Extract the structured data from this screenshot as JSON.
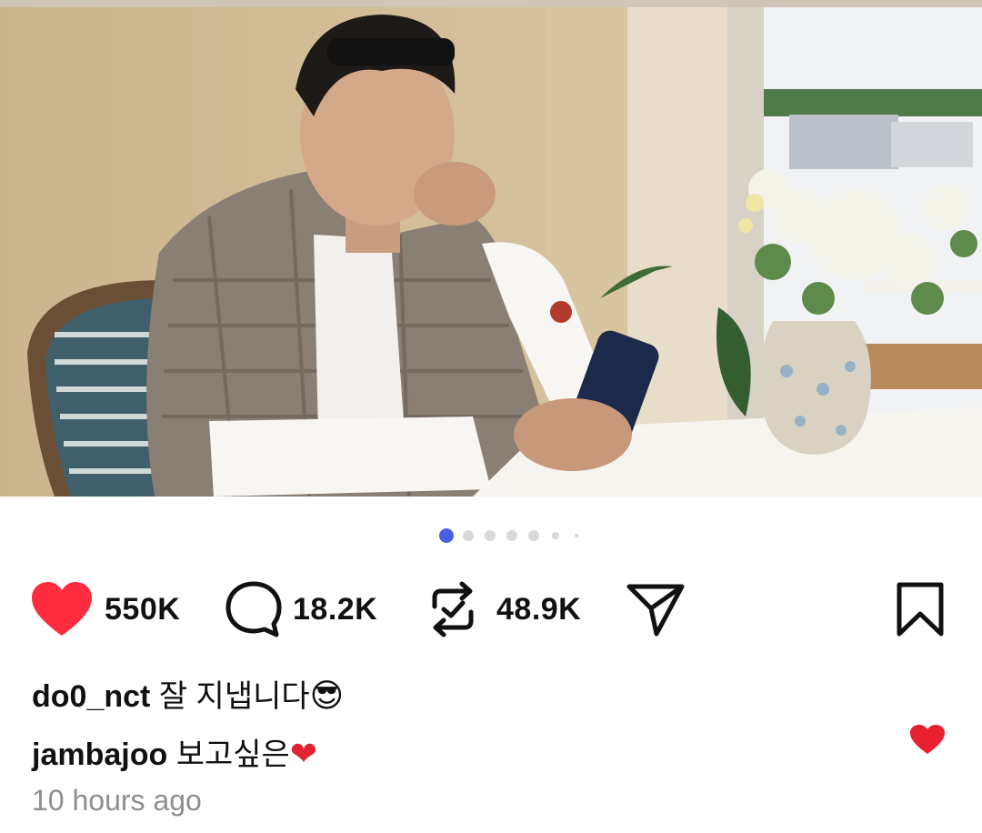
{
  "post": {
    "photo_alt": "photo-content",
    "carousel": {
      "total": 7,
      "active_index": 0
    }
  },
  "actions": {
    "likes": "550K",
    "comments": "18.2K",
    "reposts": "48.9K",
    "like_color": "#ff2d3f",
    "active_dot_color": "#4a5fe0"
  },
  "caption": {
    "username": "do0_nct",
    "text": "잘 지냅니다",
    "emoji": "😎"
  },
  "comment": {
    "username": "jambajoo",
    "text": "보고싶은",
    "emoji": "❤"
  },
  "timestamp": "10 hours ago"
}
